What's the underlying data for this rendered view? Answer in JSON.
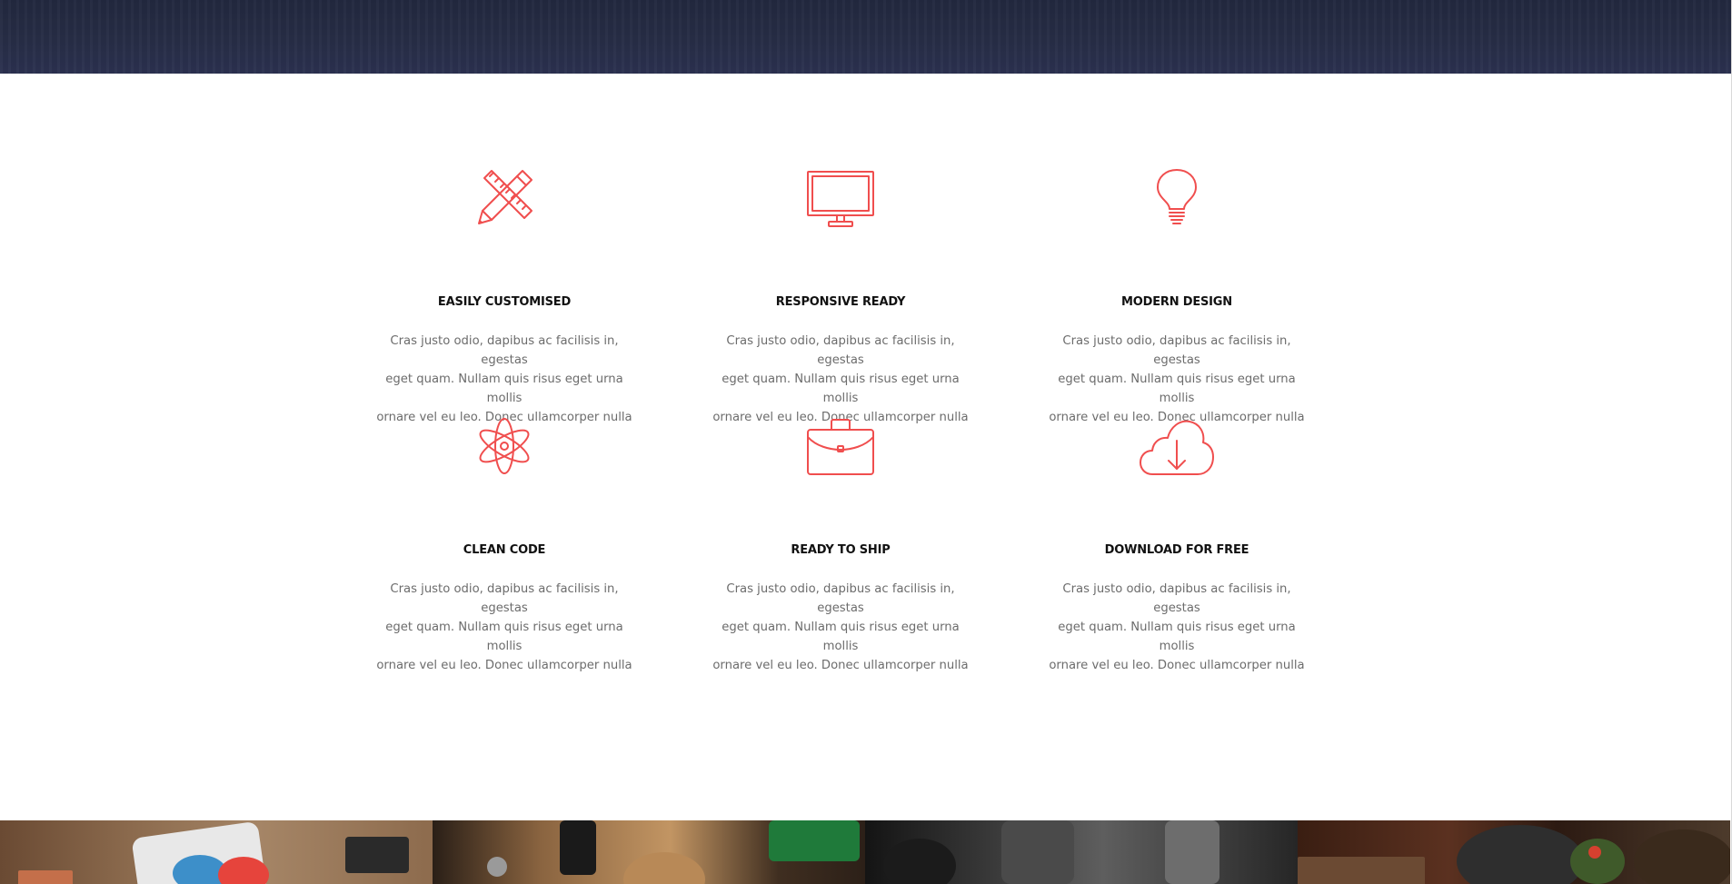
{
  "colors": {
    "accent": "#f04e4e",
    "hero_bg": "#262c45",
    "heading": "#111111",
    "body_text": "#6c6c6c"
  },
  "features": [
    {
      "icon": "ruler-pencil-icon",
      "title": "EASILY CUSTOMISED",
      "lines": [
        "Cras justo odio, dapibus ac facilisis in, egestas",
        "eget quam. Nullam quis risus eget urna mollis",
        "ornare vel eu leo. Donec ullamcorper nulla"
      ]
    },
    {
      "icon": "monitor-icon",
      "title": "RESPONSIVE READY",
      "lines": [
        "Cras justo odio, dapibus ac facilisis in, egestas",
        "eget quam. Nullam quis risus eget urna mollis",
        "ornare vel eu leo. Donec ullamcorper nulla"
      ]
    },
    {
      "icon": "lightbulb-icon",
      "title": "MODERN DESIGN",
      "lines": [
        "Cras justo odio, dapibus ac facilisis in, egestas",
        "eget quam. Nullam quis risus eget urna mollis",
        "ornare vel eu leo. Donec ullamcorper nulla"
      ]
    },
    {
      "icon": "atom-icon",
      "title": "CLEAN CODE",
      "lines": [
        "Cras justo odio, dapibus ac facilisis in, egestas",
        "eget quam. Nullam quis risus eget urna mollis",
        "ornare vel eu leo. Donec ullamcorper nulla"
      ]
    },
    {
      "icon": "briefcase-icon",
      "title": "READY TO SHIP",
      "lines": [
        "Cras justo odio, dapibus ac facilisis in, egestas",
        "eget quam. Nullam quis risus eget urna mollis",
        "ornare vel eu leo. Donec ullamcorper nulla"
      ]
    },
    {
      "icon": "cloud-download-icon",
      "title": "DOWNLOAD FOR FREE",
      "lines": [
        "Cras justo odio, dapibus ac facilisis in, egestas",
        "eget quam. Nullam quis risus eget urna mollis",
        "ornare vel eu leo. Donec ullamcorper nulla"
      ]
    }
  ],
  "gallery": {
    "images": [
      "tshirt-print-photo",
      "workshop-tools-photo",
      "camera-gear-photo",
      "mortar-herbs-photo"
    ]
  }
}
